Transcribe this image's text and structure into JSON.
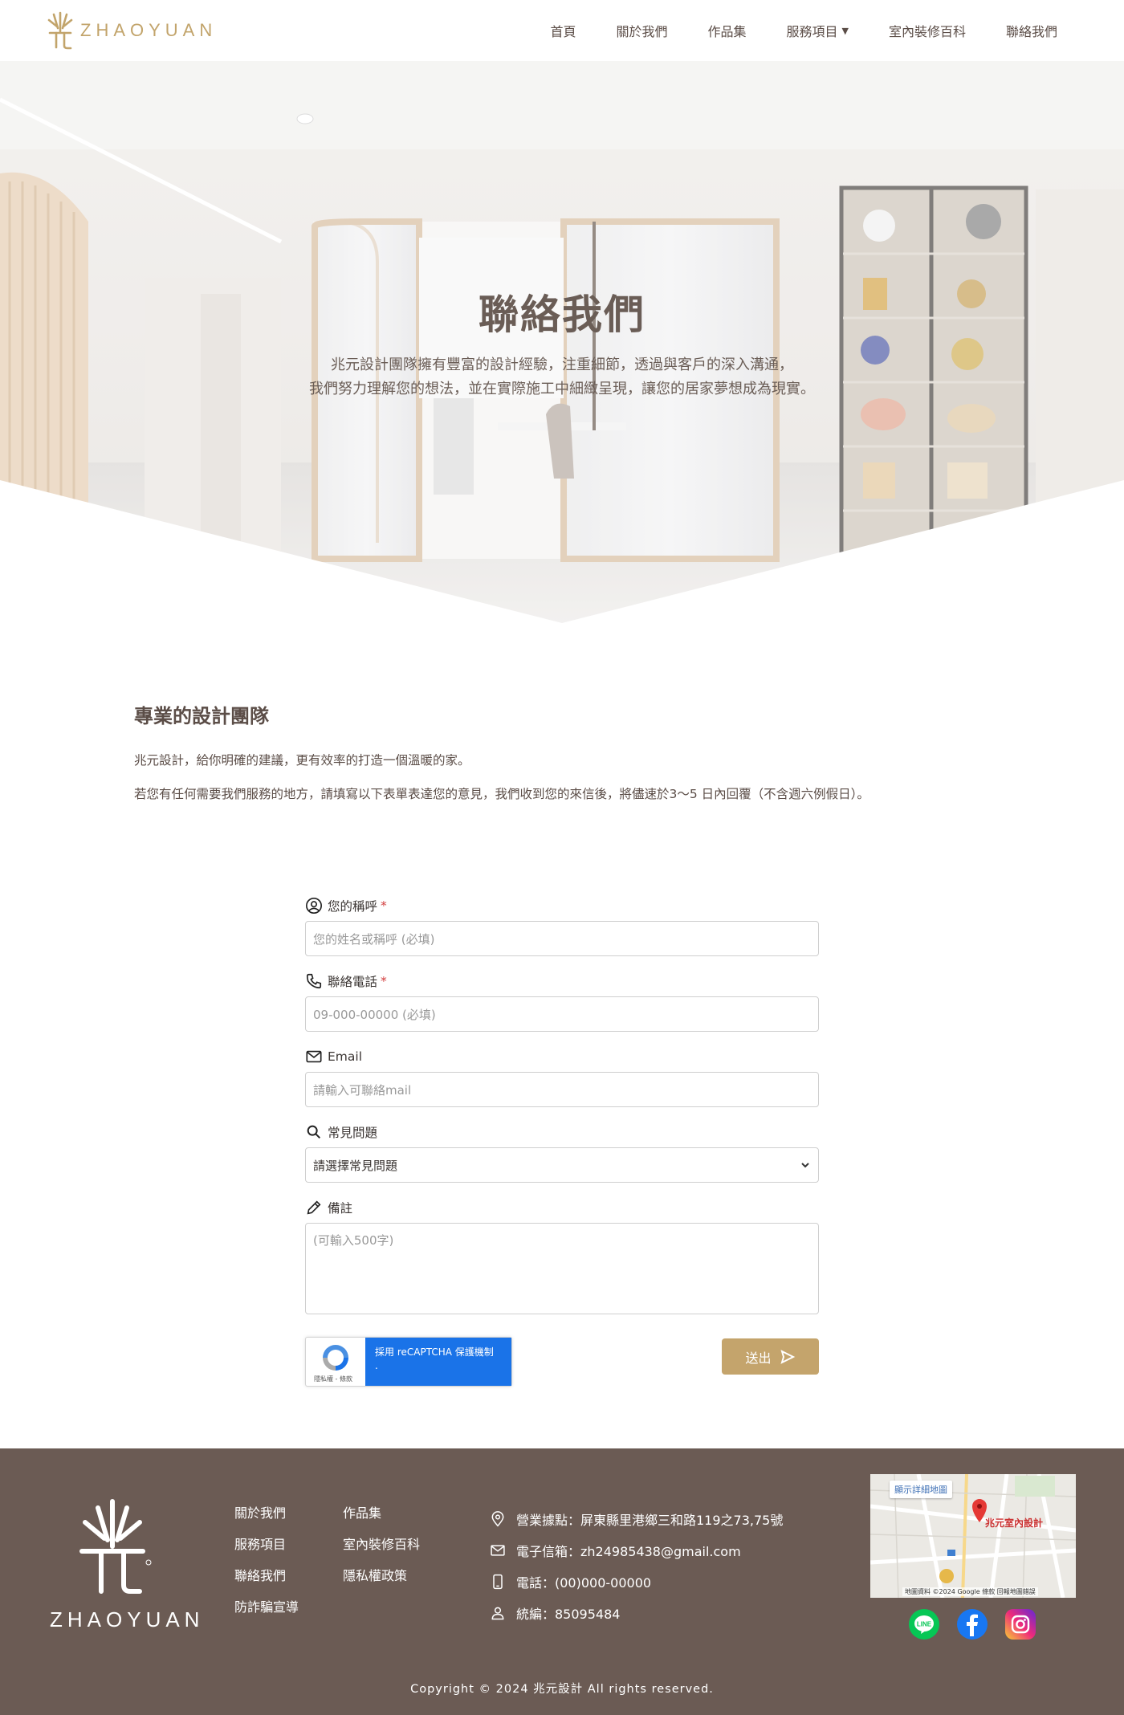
{
  "brand": {
    "logo_text": "ZHAOYUAN",
    "accent_color": "#c4a46c",
    "footer_bg": "#6b5b54"
  },
  "nav": {
    "items": [
      {
        "label": "首頁"
      },
      {
        "label": "關於我們"
      },
      {
        "label": "作品集"
      },
      {
        "label": "服務項目",
        "has_dropdown": true
      },
      {
        "label": "室內裝修百科"
      },
      {
        "label": "聯絡我們"
      }
    ]
  },
  "hero": {
    "title": "聯絡我們",
    "subtitle_line1": "兆元設計團隊擁有豐富的設計經驗，注重細節，透過與客戶的深入溝通，",
    "subtitle_line2": "我們努力理解您的想法，並在實際施工中細緻呈現，讓您的居家夢想成為現實。"
  },
  "intro": {
    "heading": "專業的設計團隊",
    "paragraph1": "兆元設計，給你明確的建議，更有效率的打造一個溫暖的家。",
    "paragraph2": "若您有任何需要我們服務的地方，請填寫以下表單表達您的意見，我們收到您的來信後，將儘速於3～5 日內回覆（不含週六例假日）。"
  },
  "form": {
    "name": {
      "label": "您的稱呼",
      "required_mark": "*",
      "placeholder": "您的姓名或稱呼 (必填)"
    },
    "phone": {
      "label": "聯絡電話",
      "required_mark": "*",
      "placeholder": "09-000-00000 (必填)"
    },
    "email": {
      "label": "Email",
      "placeholder": "請輸入可聯絡mail"
    },
    "faq": {
      "label": "常見問題",
      "selected": "請選擇常見問題"
    },
    "note": {
      "label": "備註",
      "placeholder": "(可輸入500字)"
    },
    "recaptcha": {
      "text": "採用 reCAPTCHA 保護機制",
      "privacy": "隱私權 - 條款"
    },
    "submit_label": "送出"
  },
  "footer": {
    "logo_text": "ZHAOYUAN",
    "links_col1": [
      {
        "label": "關於我們"
      },
      {
        "label": "服務項目"
      },
      {
        "label": "聯絡我們"
      },
      {
        "label": "防詐騙宣導"
      }
    ],
    "links_col2": [
      {
        "label": "作品集"
      },
      {
        "label": "室內裝修百科"
      },
      {
        "label": "隱私權政策"
      }
    ],
    "info": {
      "address": "營業據點：屏東縣里港鄉三和路119之73,75號",
      "email": "電子信箱：zh24985438@gmail.com",
      "phone": "電話：(00)000-00000",
      "tax_id": "統編：85095484"
    },
    "map": {
      "view_larger": "顯示詳細地圖",
      "place": "兆元室內設計",
      "credit": "地圖資料 ©2024 Google   條款   回報地圖錯誤"
    },
    "socials": [
      {
        "name": "line-icon",
        "color": "#06c755"
      },
      {
        "name": "facebook-icon",
        "color": "#1877f2"
      },
      {
        "name": "instagram-icon",
        "color": "#d6249f"
      }
    ],
    "copyright": "Copyright © 2024 兆元設計 All rights reserved."
  }
}
